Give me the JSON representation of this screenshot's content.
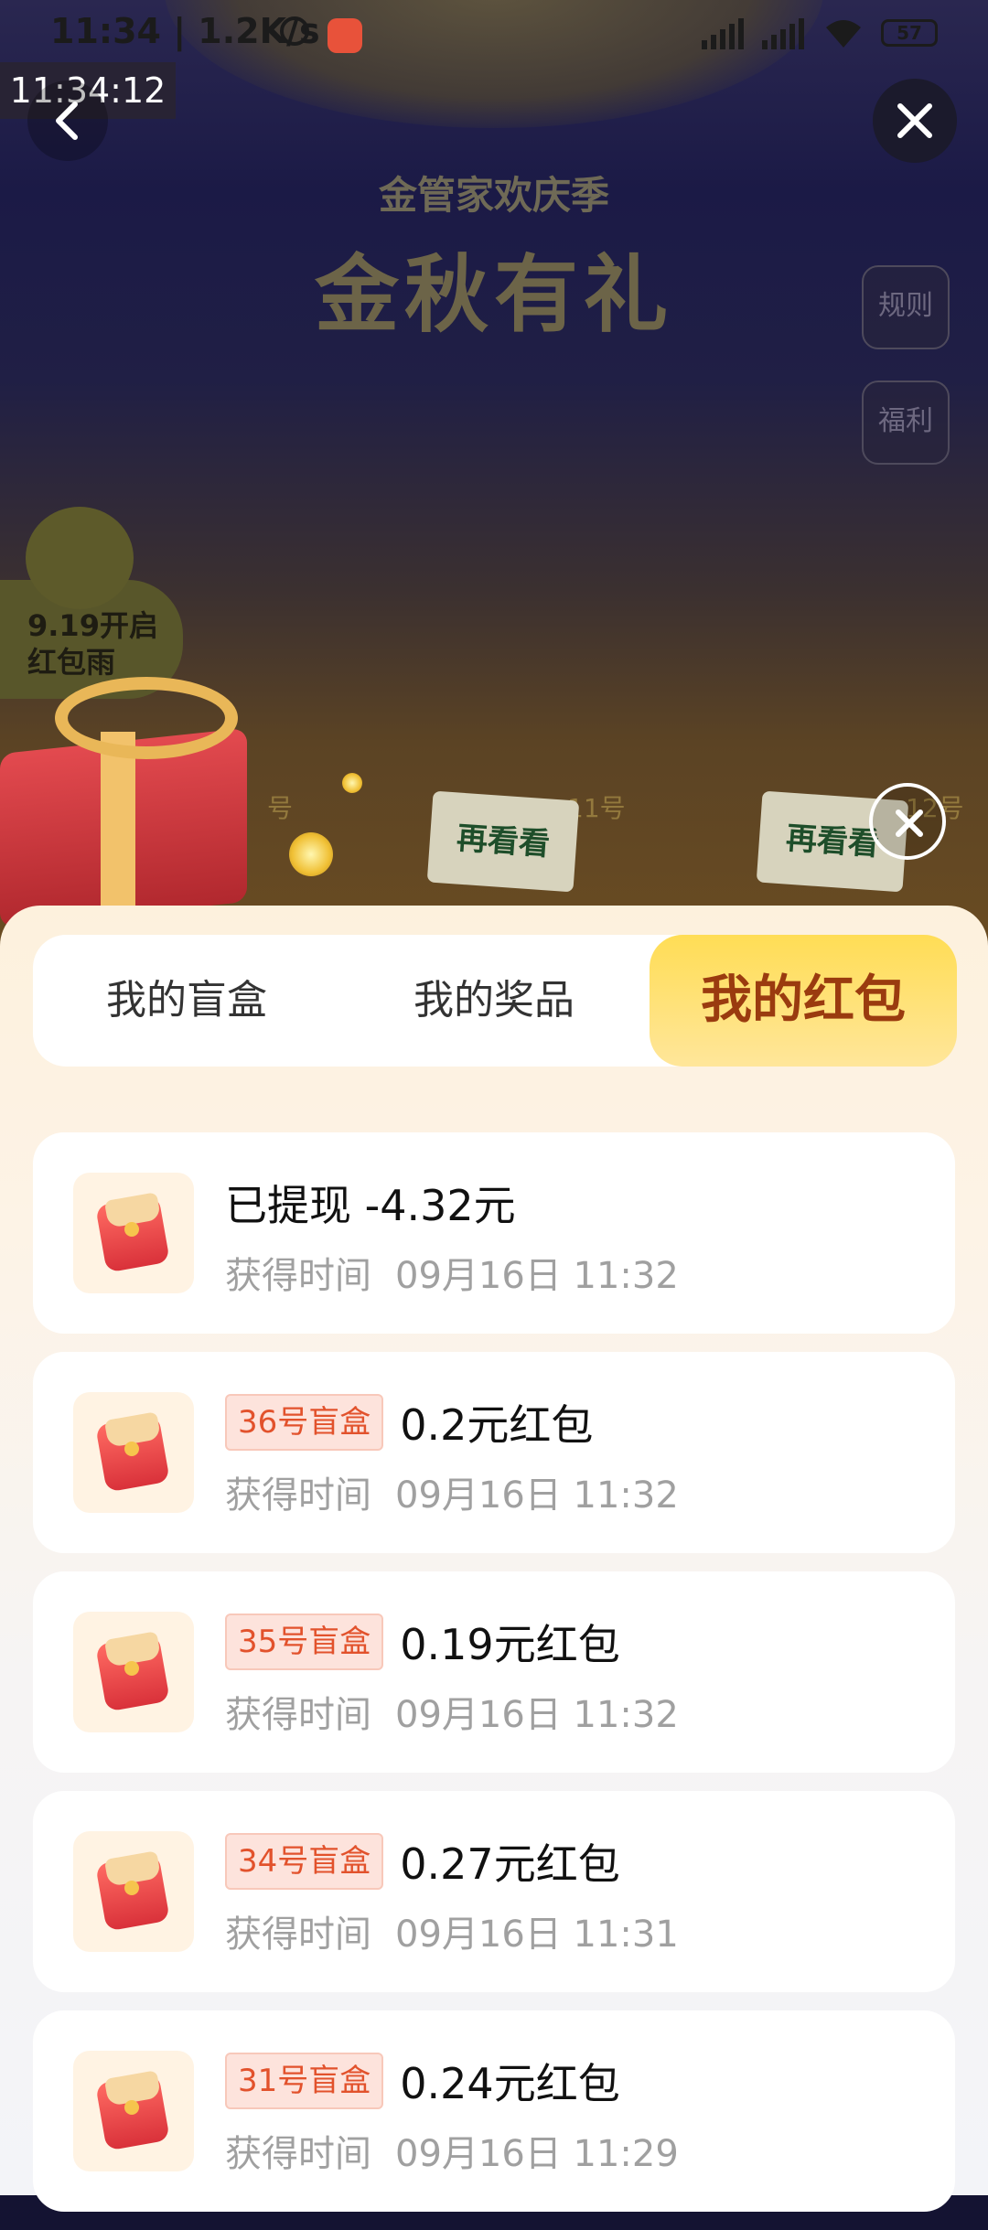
{
  "status_bar": {
    "time": "11:34 | 1.2K/s",
    "battery": "57",
    "icons": [
      "alarm-icon",
      "app-icon",
      "signal-hd-icon",
      "signal-hd-icon",
      "wifi-icon",
      "battery-icon"
    ]
  },
  "overlay_clock": "11:34:12",
  "header": {
    "season": "金管家欢庆季",
    "title": "金秋有礼",
    "rules_button": "规则",
    "welfare_button": "福利"
  },
  "promo": {
    "text_line1": "9.19开启",
    "text_line2": "红包雨"
  },
  "background_cards": {
    "label_1": "号",
    "label_2": "11号",
    "label_3": "12号",
    "card_text": "再看看"
  },
  "tabs": [
    {
      "label": "我的盲盒",
      "active": false
    },
    {
      "label": "我的奖品",
      "active": false
    },
    {
      "label": "我的红包",
      "active": true
    }
  ],
  "records": [
    {
      "badge": "",
      "title": "已提现 -4.32元",
      "time_label": "获得时间",
      "time": "09月16日 11:32"
    },
    {
      "badge": "36号盲盒",
      "title": "0.2元红包",
      "time_label": "获得时间",
      "time": "09月16日 11:32"
    },
    {
      "badge": "35号盲盒",
      "title": "0.19元红包",
      "time_label": "获得时间",
      "time": "09月16日 11:32"
    },
    {
      "badge": "34号盲盒",
      "title": "0.27元红包",
      "time_label": "获得时间",
      "time": "09月16日 11:31"
    },
    {
      "badge": "31号盲盒",
      "title": "0.24元红包",
      "time_label": "获得时间",
      "time": "09月16日 11:29"
    }
  ],
  "colors": {
    "accent_tab": "#ffdd55",
    "active_tab_text": "#9a3b0f",
    "badge_text": "#e2522c"
  }
}
